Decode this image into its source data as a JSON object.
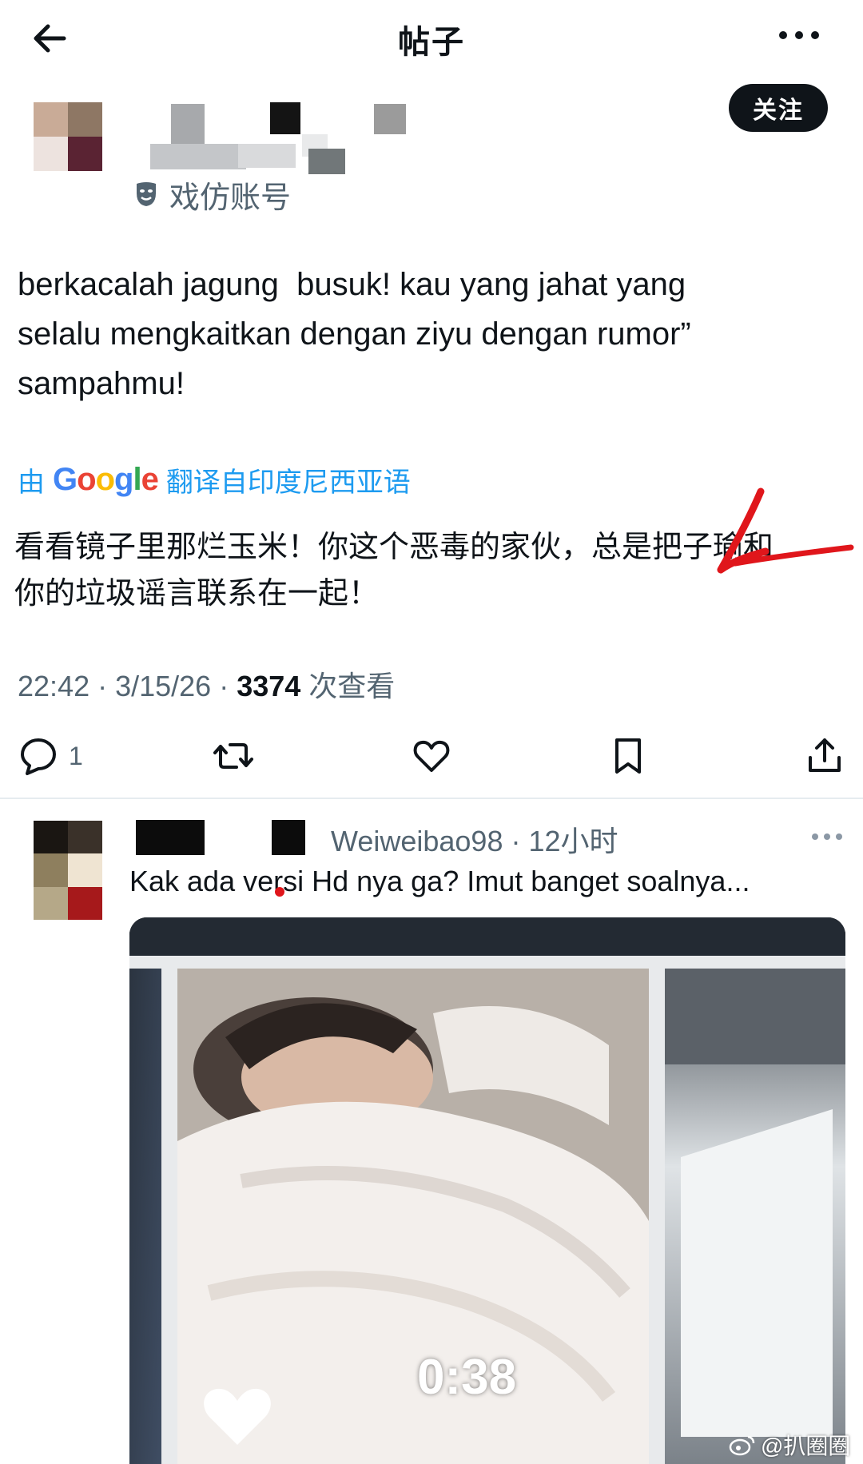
{
  "header": {
    "title": "帖子"
  },
  "post": {
    "account_label": "戏仿账号",
    "follow_label": "关注",
    "text": "berkacalah jagung  busuk! kau yang jahat yang\nselalu mengkaitkan dengan ziyu dengan rumor”\nsampahmu!",
    "translate": {
      "prefix": "由",
      "provider": "Google",
      "suffix": "翻译自印度尼西亚语"
    },
    "translated_text": "看看镜子里那烂玉米！你这个恶毒的家伙，总是把子瑜和\n你的垃圾谣言联系在一起！",
    "timestamp": "22:42 · 3/15/26 · ",
    "views_count": "3374",
    "views_label": "次查看",
    "reply_count": "1"
  },
  "reply": {
    "handle": "Weiweibao98 · 12小时",
    "text": "Kak ada versi Hd nya ga? Imut banget soalnya...",
    "video": {
      "duration": "0:38"
    }
  },
  "watermark": "@扒圈圈",
  "colors": {
    "follow_bg": "#0f1419",
    "link": "#1d9bf0",
    "muted": "#536471",
    "annotation_red": "#e0161b"
  }
}
